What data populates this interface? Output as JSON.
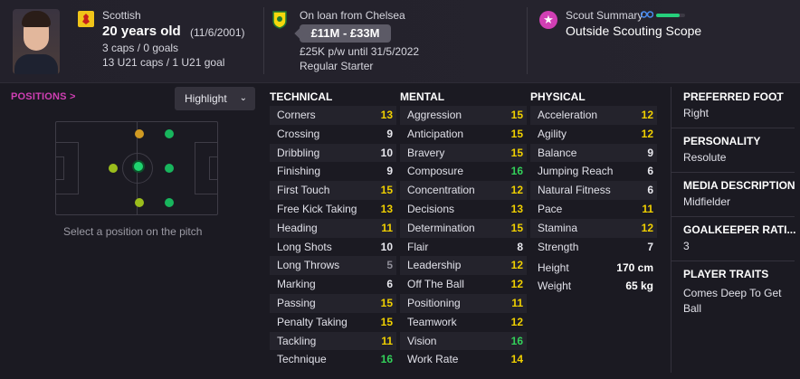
{
  "player": {
    "nationality": "Scottish",
    "age": "20 years old",
    "dob": "(11/6/2001)",
    "caps": "3 caps / 0 goals",
    "u21": "13 U21 caps / 1 U21 goal"
  },
  "contract": {
    "loan": "On loan from Chelsea",
    "value": "£11M - £33M",
    "wage": "£25K p/w until 31/5/2022",
    "status": "Regular Starter"
  },
  "scout": {
    "label": "Scout Summary",
    "value": "Outside Scouting Scope",
    "knowledge_level": 0.8
  },
  "positions": {
    "link": "POSITIONS >",
    "highlight": "Highlight",
    "caption": "Select a position on the pitch"
  },
  "columns": {
    "technical": "TECHNICAL",
    "mental": "MENTAL",
    "physical": "PHYSICAL"
  },
  "technical": [
    {
      "name": "Corners",
      "value": "13",
      "tier": "yellow"
    },
    {
      "name": "Crossing",
      "value": "9",
      "tier": "white"
    },
    {
      "name": "Dribbling",
      "value": "10",
      "tier": "white"
    },
    {
      "name": "Finishing",
      "value": "9",
      "tier": "white"
    },
    {
      "name": "First Touch",
      "value": "15",
      "tier": "yellow"
    },
    {
      "name": "Free Kick Taking",
      "value": "13",
      "tier": "yellow"
    },
    {
      "name": "Heading",
      "value": "11",
      "tier": "yellow"
    },
    {
      "name": "Long Shots",
      "value": "10",
      "tier": "white"
    },
    {
      "name": "Long Throws",
      "value": "5",
      "tier": "grey"
    },
    {
      "name": "Marking",
      "value": "6",
      "tier": "white"
    },
    {
      "name": "Passing",
      "value": "15",
      "tier": "yellow"
    },
    {
      "name": "Penalty Taking",
      "value": "15",
      "tier": "yellow"
    },
    {
      "name": "Tackling",
      "value": "11",
      "tier": "yellow"
    },
    {
      "name": "Technique",
      "value": "16",
      "tier": "green"
    }
  ],
  "mental": [
    {
      "name": "Aggression",
      "value": "15",
      "tier": "yellow"
    },
    {
      "name": "Anticipation",
      "value": "15",
      "tier": "yellow"
    },
    {
      "name": "Bravery",
      "value": "15",
      "tier": "yellow"
    },
    {
      "name": "Composure",
      "value": "16",
      "tier": "green"
    },
    {
      "name": "Concentration",
      "value": "12",
      "tier": "yellow"
    },
    {
      "name": "Decisions",
      "value": "13",
      "tier": "yellow"
    },
    {
      "name": "Determination",
      "value": "15",
      "tier": "yellow"
    },
    {
      "name": "Flair",
      "value": "8",
      "tier": "white"
    },
    {
      "name": "Leadership",
      "value": "12",
      "tier": "yellow"
    },
    {
      "name": "Off The Ball",
      "value": "12",
      "tier": "yellow"
    },
    {
      "name": "Positioning",
      "value": "11",
      "tier": "yellow"
    },
    {
      "name": "Teamwork",
      "value": "12",
      "tier": "yellow"
    },
    {
      "name": "Vision",
      "value": "16",
      "tier": "green"
    },
    {
      "name": "Work Rate",
      "value": "14",
      "tier": "yellow"
    }
  ],
  "physical": [
    {
      "name": "Acceleration",
      "value": "12",
      "tier": "yellow"
    },
    {
      "name": "Agility",
      "value": "12",
      "tier": "yellow"
    },
    {
      "name": "Balance",
      "value": "9",
      "tier": "white"
    },
    {
      "name": "Jumping Reach",
      "value": "6",
      "tier": "white"
    },
    {
      "name": "Natural Fitness",
      "value": "6",
      "tier": "white"
    },
    {
      "name": "Pace",
      "value": "11",
      "tier": "yellow"
    },
    {
      "name": "Stamina",
      "value": "12",
      "tier": "yellow"
    },
    {
      "name": "Strength",
      "value": "7",
      "tier": "white"
    }
  ],
  "physique": {
    "height_label": "Height",
    "height_value": "170 cm",
    "weight_label": "Weight",
    "weight_value": "65 kg"
  },
  "info": {
    "foot_title": "PREFERRED FOOT",
    "foot_value": "Right",
    "personality_title": "PERSONALITY",
    "personality_value": "Resolute",
    "media_title": "MEDIA DESCRIPTION",
    "media_value": "Midfielder",
    "gk_title": "GOALKEEPER RATI...",
    "gk_value": "3",
    "traits_title": "PLAYER TRAITS",
    "traits_value_1": "Comes Deep To Get",
    "traits_value_2": "Ball"
  },
  "icons": {
    "nation": "scotland-flag-icon",
    "club": "club-badge-icon",
    "scout": "star-icon",
    "binoculars": "binoculars-icon"
  },
  "colors": {
    "accent": "#d13fb4",
    "good": "#33d15a",
    "average": "#f0d000",
    "poor": "#8f8e98",
    "background": "#1b1a22"
  }
}
